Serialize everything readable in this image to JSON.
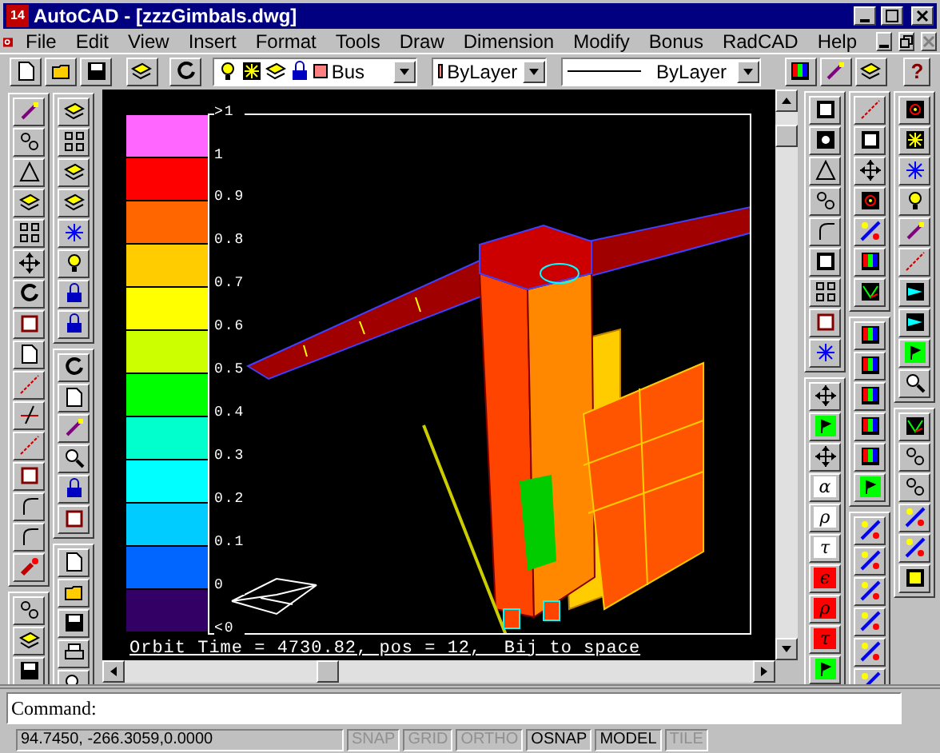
{
  "window": {
    "icon_label": "14",
    "title": "AutoCAD - [zzzGimbals.dwg]"
  },
  "menu": [
    "File",
    "Edit",
    "View",
    "Insert",
    "Format",
    "Tools",
    "Draw",
    "Dimension",
    "Modify",
    "Bonus",
    "RadCAD",
    "Help"
  ],
  "toolbar": {
    "layer": "Bus",
    "color_value": "ByLayer",
    "linetype": "ByLayer",
    "help": "?"
  },
  "symbol_buttons": [
    {
      "label": "α",
      "color": "#ffffff"
    },
    {
      "label": "ρ",
      "color": "#ffffff"
    },
    {
      "label": "τ",
      "color": "#ffffff"
    },
    {
      "label": "ϵ",
      "color": "#ff0000"
    },
    {
      "label": "ρ",
      "color": "#ff0000"
    },
    {
      "label": "τ",
      "color": "#ff0000"
    }
  ],
  "legend": [
    {
      "color": "#ff66ff"
    },
    {
      "color": "#ff0000"
    },
    {
      "color": "#ff6600"
    },
    {
      "color": "#ffcc00"
    },
    {
      "color": "#ffff00"
    },
    {
      "color": "#ccff00"
    },
    {
      "color": "#00ff00"
    },
    {
      "color": "#00ffcc"
    },
    {
      "color": "#00ffff"
    },
    {
      "color": "#00ccff"
    },
    {
      "color": "#0066ff"
    },
    {
      "color": "#330066"
    }
  ],
  "legend_labels": [
    ">1",
    "1",
    "0.9",
    "0.8",
    "0.7",
    "0.6",
    "0.5",
    "0.4",
    "0.3",
    "0.2",
    "0.1",
    "0",
    "<0"
  ],
  "caption": "Orbit Time = 4730.82, pos = 12,  Bij to space",
  "command": {
    "prompt": "Command:"
  },
  "status": {
    "coords": "94.7450, -266.3059,0.0000",
    "toggles": [
      {
        "label": "SNAP",
        "on": false
      },
      {
        "label": "GRID",
        "on": false
      },
      {
        "label": "ORTHO",
        "on": false
      },
      {
        "label": "OSNAP",
        "on": true
      },
      {
        "label": "MODEL",
        "on": true
      },
      {
        "label": "TILE",
        "on": false
      }
    ]
  }
}
